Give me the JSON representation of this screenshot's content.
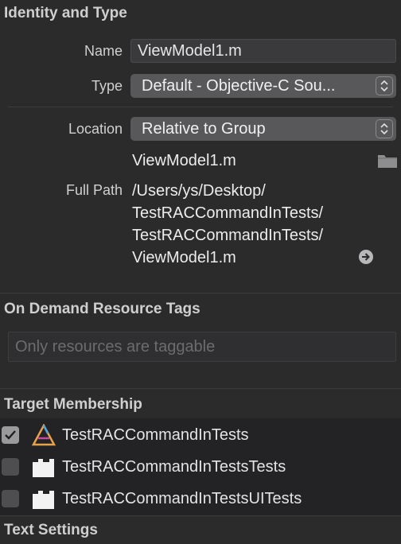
{
  "identity": {
    "header": "Identity and Type",
    "name_label": "Name",
    "name_value": "ViewModel1.m",
    "type_label": "Type",
    "type_value": "Default - Objective-C Sou...",
    "location_label": "Location",
    "location_value": "Relative to Group",
    "file_name": "ViewModel1.m",
    "full_path_label": "Full Path",
    "full_path_lines": [
      "/Users/ys/Desktop/",
      "TestRACCommandInTests/",
      "TestRACCommandInTests/",
      "ViewModel1.m"
    ]
  },
  "on_demand": {
    "header": "On Demand Resource Tags",
    "placeholder": "Only resources are taggable"
  },
  "membership": {
    "header": "Target Membership",
    "targets": [
      {
        "label": "TestRACCommandInTests",
        "checked": true,
        "icon": "app-icon"
      },
      {
        "label": "TestRACCommandInTestsTests",
        "checked": false,
        "icon": "test-bundle-icon"
      },
      {
        "label": "TestRACCommandInTestsUITests",
        "checked": false,
        "icon": "test-bundle-icon"
      }
    ]
  },
  "text_settings": {
    "header": "Text Settings"
  },
  "colors": {
    "background": "#2b2b2c",
    "popup": "#58585a",
    "field": "#3a3a3c"
  }
}
